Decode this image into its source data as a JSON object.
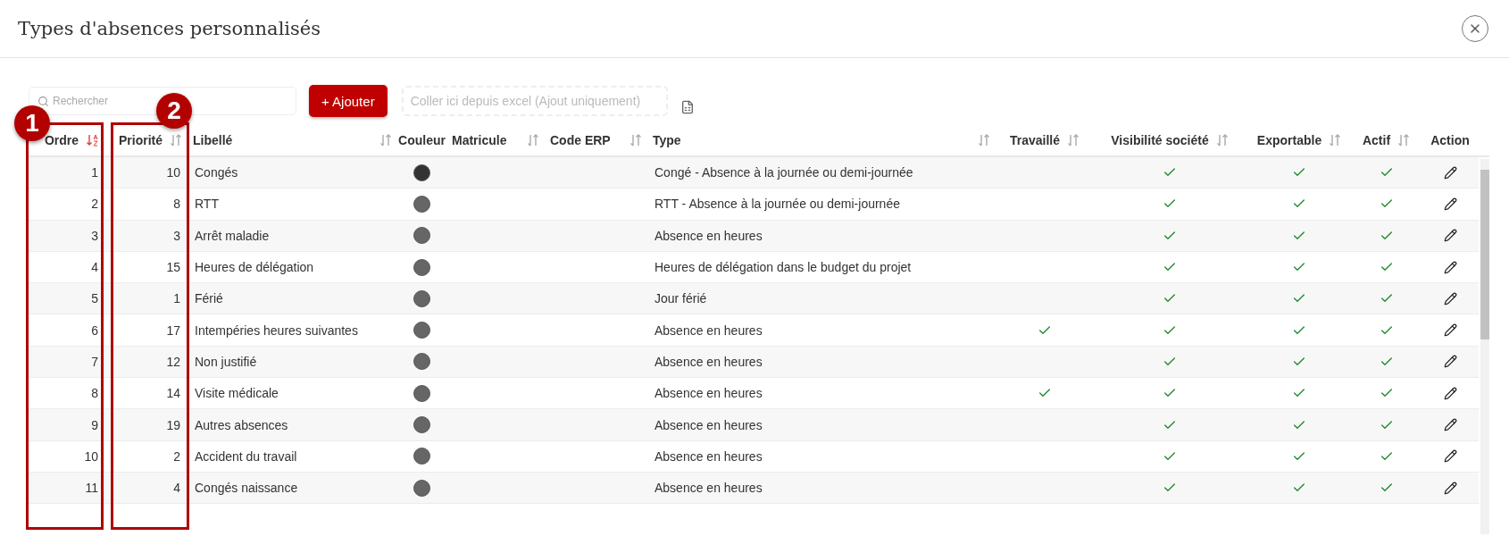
{
  "window": {
    "title": "Types d'absences personnalisés"
  },
  "toolbar": {
    "search": {
      "placeholder": "Rechercher"
    },
    "add_button": {
      "label": "+ Ajouter"
    },
    "paste_area": {
      "placeholder": "Coller ici depuis excel (Ajout uniquement)"
    }
  },
  "annotations": [
    {
      "label": "1"
    },
    {
      "label": "2"
    }
  ],
  "table": {
    "columns": [
      {
        "label": "Ordre",
        "kind": "number",
        "sorted": true
      },
      {
        "label": "Priorité",
        "kind": "number",
        "sorted": false
      },
      {
        "label": "Libellé",
        "kind": "text",
        "sorted": false
      },
      {
        "label": "Couleur",
        "kind": "color"
      },
      {
        "label": "Matricule",
        "kind": "text",
        "sorted": false
      },
      {
        "label": "Code ERP",
        "kind": "text",
        "sorted": false
      },
      {
        "label": "Type",
        "kind": "text",
        "sorted": false
      },
      {
        "label": "Travaillé",
        "kind": "check",
        "sorted": false
      },
      {
        "label": "Visibilité société",
        "kind": "check",
        "sorted": false
      },
      {
        "label": "Exportable",
        "kind": "check",
        "sorted": false
      },
      {
        "label": "Actif",
        "kind": "check",
        "sorted": false
      },
      {
        "label": "Action",
        "kind": "action"
      }
    ],
    "rows": [
      {
        "ordre": "1",
        "priorite": "10",
        "libelle": "Congés",
        "color": "#333333",
        "type": "Congé - Absence à la journée ou demi-journée",
        "travaille": false,
        "visibilite": true,
        "exportable": true,
        "actif": true
      },
      {
        "ordre": "2",
        "priorite": "8",
        "libelle": "RTT",
        "color": "#666666",
        "type": "RTT - Absence à la journée ou demi-journée",
        "travaille": false,
        "visibilite": true,
        "exportable": true,
        "actif": true
      },
      {
        "ordre": "3",
        "priorite": "3",
        "libelle": "Arrêt maladie",
        "color": "#666666",
        "type": "Absence en heures",
        "travaille": false,
        "visibilite": true,
        "exportable": true,
        "actif": true
      },
      {
        "ordre": "4",
        "priorite": "15",
        "libelle": "Heures de délégation",
        "color": "#666666",
        "type": "Heures de délégation dans le budget du projet",
        "travaille": false,
        "visibilite": true,
        "exportable": true,
        "actif": true
      },
      {
        "ordre": "5",
        "priorite": "1",
        "libelle": "Férié",
        "color": "#666666",
        "type": "Jour férié",
        "travaille": false,
        "visibilite": true,
        "exportable": true,
        "actif": true
      },
      {
        "ordre": "6",
        "priorite": "17",
        "libelle": "Intempéries heures suivantes",
        "color": "#666666",
        "type": "Absence en heures",
        "travaille": true,
        "visibilite": true,
        "exportable": true,
        "actif": true
      },
      {
        "ordre": "7",
        "priorite": "12",
        "libelle": "Non justifié",
        "color": "#666666",
        "type": "Absence en heures",
        "travaille": false,
        "visibilite": true,
        "exportable": true,
        "actif": true
      },
      {
        "ordre": "8",
        "priorite": "14",
        "libelle": "Visite médicale",
        "color": "#666666",
        "type": "Absence en heures",
        "travaille": true,
        "visibilite": true,
        "exportable": true,
        "actif": true
      },
      {
        "ordre": "9",
        "priorite": "19",
        "libelle": "Autres absences",
        "color": "#666666",
        "type": "Absence en heures",
        "travaille": false,
        "visibilite": true,
        "exportable": true,
        "actif": true
      },
      {
        "ordre": "10",
        "priorite": "2",
        "libelle": "Accident du travail",
        "color": "#666666",
        "type": "Absence en heures",
        "travaille": false,
        "visibilite": true,
        "exportable": true,
        "actif": true
      },
      {
        "ordre": "11",
        "priorite": "4",
        "libelle": "Congés naissance",
        "color": "#666666",
        "type": "Absence en heures",
        "travaille": false,
        "visibilite": true,
        "exportable": true,
        "actif": true
      }
    ]
  }
}
